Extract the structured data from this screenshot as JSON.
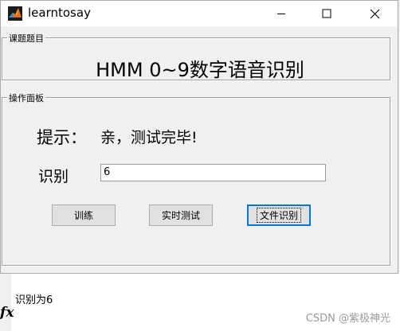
{
  "window": {
    "title": "learntosay",
    "icon": "matlab-icon",
    "controls": [
      "minimize-icon",
      "maximize-icon",
      "close-icon"
    ]
  },
  "topic_panel": {
    "legend": "课题题目",
    "title": "HMM 0~9数字语音识别"
  },
  "ops_panel": {
    "legend": "操作面板",
    "hint_label": "提示：",
    "hint_text": "亲，测试完毕!",
    "recognize_label": "识别",
    "recognize_value": "6",
    "buttons": {
      "train": "训练",
      "live_test": "实时测试",
      "file_recognize": "文件识别"
    }
  },
  "console": {
    "fx_symbol": "fx",
    "output": "识别为6"
  },
  "watermark": "CSDN @紫极神光"
}
